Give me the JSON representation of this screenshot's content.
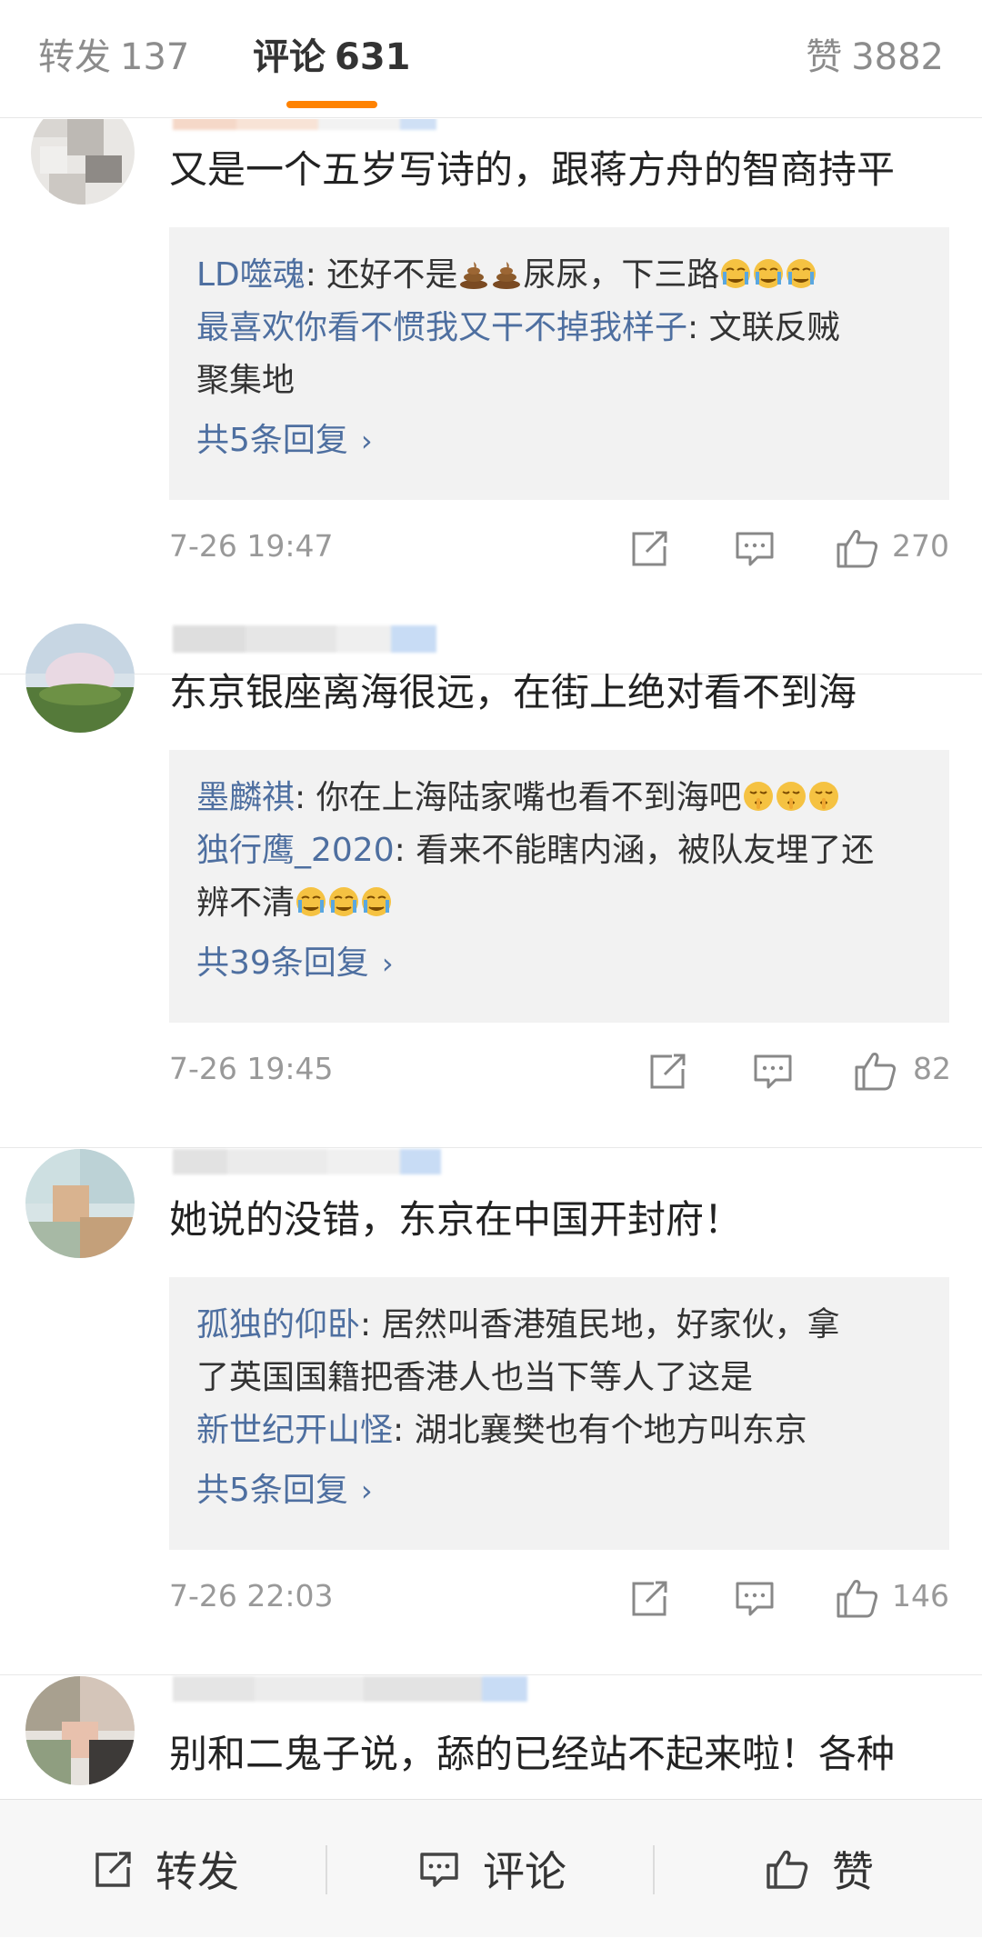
{
  "tabs": {
    "repost": {
      "label": "转发",
      "count": "137"
    },
    "comment": {
      "label": "评论",
      "count": "631"
    },
    "likes": {
      "label": "赞",
      "count": "3882"
    }
  },
  "comments": [
    {
      "text": "又是一个五岁写诗的，跟蒋方舟的智商持平",
      "replies": [
        {
          "name": "LD噬魂",
          "before": ": 还好不是",
          "emoji1": "pile-of-poo",
          "after": "尿尿，下三路",
          "emoji2": "crying-face"
        },
        {
          "name": "最喜欢你看不惯我又干不掉我样子",
          "line1": ": 文联反贼",
          "line2": "聚集地"
        }
      ],
      "more": "共5条回复",
      "time": "7-26 19:47",
      "likes": "270"
    },
    {
      "text": "东京银座离海很远，在街上绝对看不到海",
      "replies": [
        {
          "name": "墨麟祺",
          "before": ": 你在上海陆家嘴也看不到海吧",
          "emoji": "shushing-face"
        },
        {
          "name": "独行鹰_2020",
          "line1": ": 看来不能瞎内涵，被队友埋了还",
          "line2": "辨不清",
          "emoji": "crying-face"
        }
      ],
      "more": "共39条回复",
      "time": "7-26 19:45",
      "likes": "82"
    },
    {
      "text": "她说的没错，东京在中国开封府！",
      "replies": [
        {
          "name": "孤独的仰卧",
          "line1": ": 居然叫香港殖民地，好家伙，拿",
          "line2": "了英国国籍把香港人也当下等人了这是"
        },
        {
          "name": "新世纪开山怪",
          "before": ": 湖北襄樊也有个地方叫东京"
        }
      ],
      "more": "共5条回复",
      "time": "7-26 22:03",
      "likes": "146"
    },
    {
      "text": "别和二鬼子说，舔的已经站不起来啦！各种"
    }
  ],
  "bottom": {
    "repost": "转发",
    "comment": "评论",
    "like": "赞"
  },
  "colors": {
    "accent": "#ff8200",
    "link": "#4e6fa0"
  }
}
